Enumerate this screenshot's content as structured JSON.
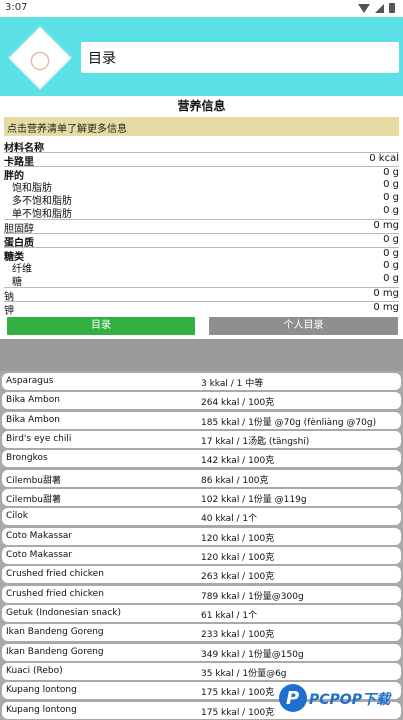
{
  "status": {
    "time": "3:07"
  },
  "header": {
    "title": "目录"
  },
  "nutrition": {
    "title": "营养信息",
    "notice": "点击营养清单了解更多信息",
    "rows": [
      {
        "label": "材料名称",
        "value": ""
      },
      {
        "label": "卡路里",
        "value": "0 kcal"
      },
      {
        "label": "胖的",
        "value": "0 g"
      },
      {
        "label": "饱和脂肪",
        "value": "0 g"
      },
      {
        "label": "多不饱和脂肪",
        "value": "0 g"
      },
      {
        "label": "单不饱和脂肪",
        "value": "0 g"
      },
      {
        "label": "胆固醇",
        "value": "0 mg"
      },
      {
        "label": "蛋白质",
        "value": "0 g"
      },
      {
        "label": "糖类",
        "value": "0 g"
      },
      {
        "label": "纤维",
        "value": "0 g"
      },
      {
        "label": "糖",
        "value": "0 g"
      },
      {
        "label": "钠",
        "value": "0 mg"
      },
      {
        "label": "钾",
        "value": "0 mg"
      }
    ]
  },
  "buttons": {
    "catalog": "目录",
    "personal": "个人目录"
  },
  "foods": [
    {
      "name": "Asparagus",
      "cal": "3 kkal / 1 中等"
    },
    {
      "name": "Bika Ambon",
      "cal": "264 kkal / 100克"
    },
    {
      "name": "Bika Ambon",
      "cal": "185 kkal / 1份量 @70g (fènliàng @70g)"
    },
    {
      "name": "Bird's eye chili",
      "cal": "17 kkal / 1汤匙 (tāngshi)"
    },
    {
      "name": "Brongkos",
      "cal": "142 kkal / 100克"
    },
    {
      "name": "Cilembu甜薯",
      "cal": "86 kkal / 100克"
    },
    {
      "name": "Cilembu甜薯",
      "cal": "102 kkal / 1份量 @119g"
    },
    {
      "name": "Cilok",
      "cal": "40 kkal / 1个"
    },
    {
      "name": "Coto Makassar",
      "cal": "120 kkal / 100克"
    },
    {
      "name": "Coto Makassar",
      "cal": "120 kkal / 100克"
    },
    {
      "name": "Crushed fried chicken",
      "cal": "263 kkal / 100克"
    },
    {
      "name": "Crushed fried chicken",
      "cal": "789 kkal / 1份量@300g"
    },
    {
      "name": "Getuk (Indonesian snack)",
      "cal": "61 kkal / 1个"
    },
    {
      "name": "Ikan Bandeng Goreng",
      "cal": "233 kkal / 100克"
    },
    {
      "name": "Ikan Bandeng Goreng",
      "cal": "349 kkal / 1份量@150g"
    },
    {
      "name": "Kuaci (Rebo)",
      "cal": "35 kkal / 1份量@6g"
    },
    {
      "name": "Kupang lontong",
      "cal": "175 kkal / 100克"
    },
    {
      "name": "Kupang lontong",
      "cal": "175 kkal / 100克"
    }
  ],
  "watermark": {
    "text": "PCPOP下载"
  }
}
